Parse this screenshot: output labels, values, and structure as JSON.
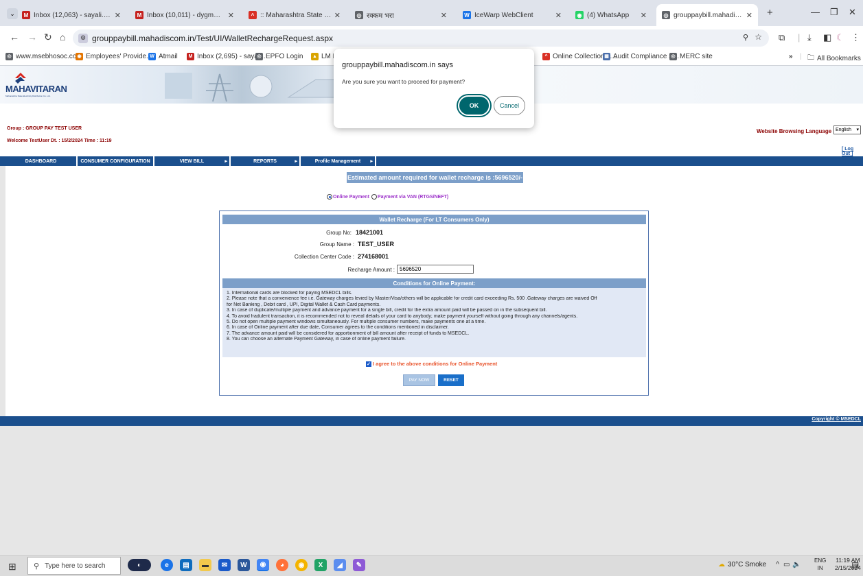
{
  "browser": {
    "tabs": [
      {
        "label": "Inbox (12,063) - sayali.javeri1@",
        "icon": "gmail-icon",
        "color": "#c5221f",
        "glyph": "M"
      },
      {
        "label": "Inbox (10,011) - dygmmumbai@",
        "icon": "gmail-icon",
        "color": "#c5221f",
        "glyph": "M"
      },
      {
        "label": ":: Maharashtra State Electricity",
        "icon": "mahavitaran-icon",
        "color": "#d93025",
        "glyph": "^"
      },
      {
        "label": "रक्कम भरा",
        "icon": "globe-icon",
        "color": "#5f6368",
        "glyph": "◎"
      },
      {
        "label": "IceWarp WebClient",
        "icon": "icewarp-icon",
        "color": "#1a73e8",
        "glyph": "W"
      },
      {
        "label": "(4) WhatsApp",
        "icon": "whatsapp-icon",
        "color": "#25d366",
        "glyph": "◉"
      },
      {
        "label": "grouppaybill.mahadiscom.in/Te",
        "icon": "globe-icon",
        "color": "#5f6368",
        "glyph": "◎"
      }
    ],
    "url": "grouppaybill.mahadiscom.in/Test/UI/WalletRechargeRequest.aspx",
    "bookmarks": [
      {
        "label": "www.msebhosoc.com",
        "color": "#5f6368",
        "glyph": "◎"
      },
      {
        "label": "Employees' Provide...",
        "color": "#e37400",
        "glyph": "◉"
      },
      {
        "label": "Atmail",
        "color": "#1a73e8",
        "glyph": "W"
      },
      {
        "label": "Inbox (2,695) - sayal...",
        "color": "#c5221f",
        "glyph": "M"
      },
      {
        "label": "EPFO Login",
        "color": "#5f6368",
        "glyph": "◎"
      },
      {
        "label": "LM Portal",
        "color": "#d9a400",
        "glyph": "▲"
      },
      {
        "label": "Online Collection &...",
        "color": "#d93025",
        "glyph": "^"
      },
      {
        "label": "Audit Compliance S...",
        "color": "#4a6eab",
        "glyph": "▦"
      },
      {
        "label": "MERC site",
        "color": "#5f6368",
        "glyph": "◎"
      }
    ],
    "all_bookmarks": "All Bookmarks"
  },
  "site": {
    "logo_text": "MAHAVITARAN",
    "logo_sub": "Maharashtra State Electricity Distribution Co. Ltd.",
    "group_label": "Group : GROUP PAY TEST USER",
    "welcome": "Welcome TestUser Dt. : 15/2/2024 Time : 11:19",
    "lang_label": "Website Browsing Language",
    "lang_value": "English",
    "logout": "[ Log Out ]",
    "menu": [
      {
        "label": "DASHBOARD",
        "arrow": ""
      },
      {
        "label": "CONSUMER CONFIGURATION",
        "arrow": ""
      },
      {
        "label": "VIEW BILL",
        "arrow": "▸"
      },
      {
        "label": "REPORTS",
        "arrow": "▸"
      },
      {
        "label": "Profile Management",
        "arrow": "▸"
      }
    ],
    "estimated": "Estimated amount required for wallet recharge is :5696520/-",
    "radio_online": "Online Payment",
    "radio_van": "Payment via VAN (RTGS/NEFT)",
    "panel_title": "Wallet Recharge (For LT Consumers Only)",
    "fields": {
      "group_no_label": "Group No:",
      "group_no": "18421001",
      "group_name_label": "Group Name :",
      "group_name": "TEST_USER",
      "ccc_label": "Collection Center Code :",
      "ccc": "274168001",
      "amount_label": "Recharge Amount :",
      "amount": "5696520"
    },
    "conditions_title": "Conditions for Online Payment:",
    "conditions": [
      "1. International cards are blocked for paying MSEDCL bills.",
      "2. Please note that a convenience fee i.e. Gateway charges levied by Master/Visa/others will be applicable for credit card exceeding Rs. 500 .Gateway charges are waived Off",
      "for Net Banking , Debit card , UPI, Digital Wallet & Cash Card payments.",
      "3. In case of duplicate/multiple payment and advance payment for a single bill, credit for the extra amount paid will be passed on in the subsequent bill.",
      "4. To avoid fradulent transaction, it is recommended not to reveal details of your card to anybody; make payment yourself without going through any channels/agents.",
      "5. Do not open multiple payment windows simultaneously. For multiple consumer numbers, make payments one at a time.",
      "6. In case of Online payment after due date, Consumer agrees to the conditions mentioned in disclaimer.",
      "7. The advance amount paid will be considered for apportionment of bill amount after receipt of funds to MSEDCL.",
      "8. You can choose an alternate Payment Gateway, in case of online payment failure."
    ],
    "agree": "I agree to the above conditions for Online Payment",
    "pay_now": "PAY NOW",
    "reset": "RESET",
    "copyright": "Copyright © MSEDCL"
  },
  "dialog": {
    "title": "grouppaybill.mahadiscom.in says",
    "message": "Are you sure you want to proceed for payment?",
    "ok": "OK",
    "cancel": "Cancel"
  },
  "taskbar": {
    "search_placeholder": "Type here to search",
    "weather": "30°C Smoke",
    "lang_top": "ENG",
    "lang_bottom": "IN",
    "time": "11:19 AM",
    "date": "2/15/2024",
    "notif_count": "3"
  }
}
